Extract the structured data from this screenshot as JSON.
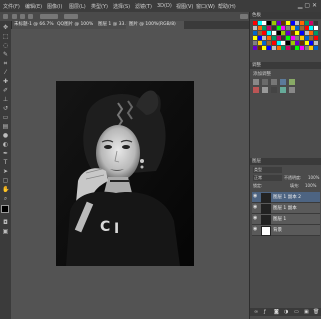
{
  "menubar": {
    "items": [
      "文件(F)",
      "编辑(E)",
      "图像(I)",
      "图层(L)",
      "类型(Y)",
      "选择(S)",
      "滤镜(T)",
      "3D(D)",
      "视图(V)",
      "窗口(W)",
      "帮助(H)"
    ]
  },
  "tabs": [
    {
      "label": "未标题-1 @ 66.7%"
    },
    {
      "label": "QQ图片 @ 100%"
    },
    {
      "label": "图层 1 @ 33.3%"
    },
    {
      "label": "图片 @ 100%(RGB/8)"
    }
  ],
  "panels": {
    "swatches_title": "色板",
    "adjust_title": "调整",
    "adjust_label": "添加调整",
    "layers_title": "图层",
    "kind_label": "类型",
    "mode_label": "正常",
    "opacity_label": "不透明度:",
    "opacity_value": "100%",
    "lock_label": "锁定:",
    "fill_label": "填充:",
    "fill_value": "100%"
  },
  "layers": [
    {
      "name": "图层 1 副本 2",
      "selected": true
    },
    {
      "name": "图层 1 副本",
      "selected": false
    },
    {
      "name": "图层 1",
      "selected": false
    },
    {
      "name": "背景",
      "selected": false
    }
  ],
  "colors": {
    "ui_dark": "#3c3c3c",
    "canvas_bg": "#535353",
    "selected_layer": "#4d6482",
    "fg_color": "#000000",
    "bg_color": "#ffffff"
  }
}
